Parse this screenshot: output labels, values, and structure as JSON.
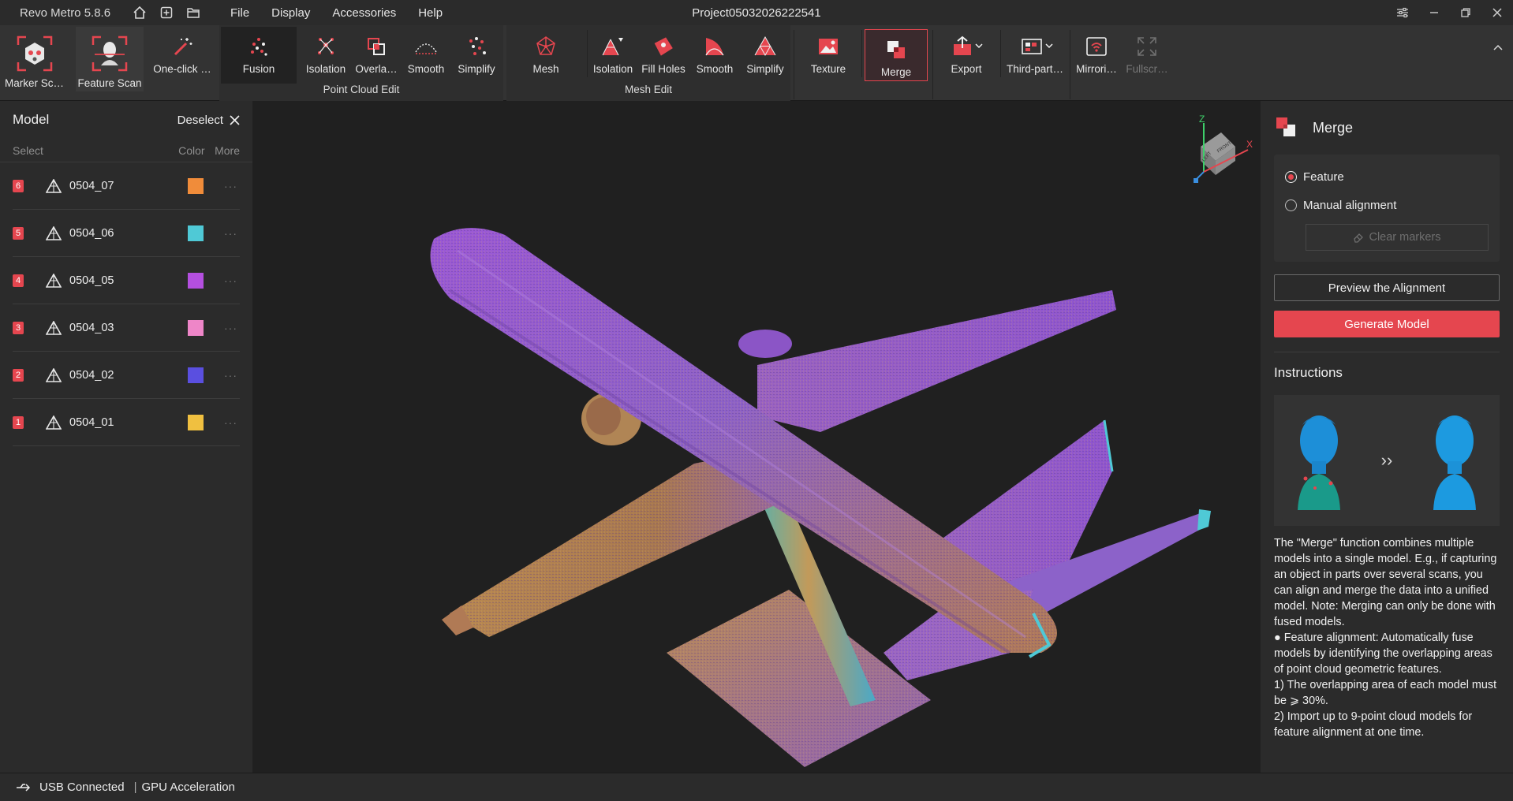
{
  "titlebar": {
    "app_title": "Revo Metro 5.8.6",
    "menu": [
      "File",
      "Display",
      "Accessories",
      "Help"
    ],
    "project": "Project05032026222541"
  },
  "toolbar": {
    "marker_scan": "Marker Scan",
    "feature_scan": "Feature Scan",
    "one_click": "One-click …",
    "pc_fusion": "Fusion",
    "pc_isolation": "Isolation",
    "pc_overlap": "Overla…",
    "pc_smooth": "Smooth",
    "pc_simplify": "Simplify",
    "pc_group": "Point Cloud Edit",
    "mesh": "Mesh",
    "mesh_isolation": "Isolation",
    "mesh_fill": "Fill Holes",
    "mesh_smooth": "Smooth",
    "mesh_simplify": "Simplify",
    "mesh_group": "Mesh Edit",
    "texture": "Texture",
    "merge": "Merge",
    "export": "Export",
    "third_party": "Third-part…",
    "mirroring": "Mirrori…",
    "fullscreen": "Fullscr…"
  },
  "model_panel": {
    "title": "Model",
    "deselect": "Deselect",
    "col_select": "Select",
    "col_color": "Color",
    "col_more": "More",
    "models": [
      {
        "index": "6",
        "name": "0504_07",
        "color": "#f08c3a"
      },
      {
        "index": "5",
        "name": "0504_06",
        "color": "#4fc9d6"
      },
      {
        "index": "4",
        "name": "0504_05",
        "color": "#b44fe0"
      },
      {
        "index": "3",
        "name": "0504_03",
        "color": "#ee86c8"
      },
      {
        "index": "2",
        "name": "0504_02",
        "color": "#5a4fe0"
      },
      {
        "index": "1",
        "name": "0504_01",
        "color": "#f0c040"
      }
    ]
  },
  "axis": {
    "z": "Z",
    "x": "X",
    "front": "FRONT",
    "left": "LEFT"
  },
  "merge_panel": {
    "title": "Merge",
    "opt_feature": "Feature",
    "opt_manual": "Manual alignment",
    "clear_markers": "Clear markers",
    "preview": "Preview the Alignment",
    "generate": "Generate Model",
    "instructions_title": "Instructions",
    "arrows": "››",
    "instructions": [
      "The \"Merge\" function combines multiple models into a single model. E.g., if capturing an object in parts over several scans, you can align and merge the data into a unified model. Note: Merging can only be done with fused models.",
      "● Feature alignment: Automatically fuse models by identifying the overlapping areas of point cloud geometric features.",
      "1) The overlapping area of each model must be ⩾ 30%.",
      "2) Import up to 9-point cloud models for feature alignment at one time."
    ]
  },
  "statusbar": {
    "usb": "USB Connected",
    "sep": "|",
    "gpu": "GPU Acceleration"
  },
  "colors": {
    "accent": "#e5464f",
    "panel": "#2b2b2b",
    "viewport": "#202020"
  }
}
